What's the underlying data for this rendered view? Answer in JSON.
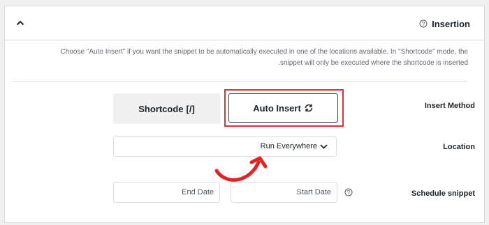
{
  "header": {
    "title": "Insertion"
  },
  "description": {
    "line1": "Choose \"Auto Insert\" if you want the snippet to be automatically executed in one of the locations available. In \"Shortcode\" mode, the",
    "line2": ".snippet will only be executed where the shortcode is inserted"
  },
  "insert_method": {
    "label": "Insert Method",
    "shortcode_label": "Shortcode",
    "shortcode_glyph": "[/]",
    "auto_insert_label": "Auto Insert",
    "selected": "Auto Insert"
  },
  "location": {
    "label": "Location",
    "value": "Run Everywhere"
  },
  "schedule": {
    "label": "Schedule snippet",
    "start_placeholder": "Start Date",
    "end_placeholder": "End Date"
  },
  "colors": {
    "highlight": "#d63638",
    "selected_border": "#2c3e73",
    "annotation_arrow": "#e02424"
  },
  "icons": [
    "chevron-up-icon",
    "help-icon",
    "refresh-icon",
    "chevron-down-icon",
    "curved-arrow-annotation"
  ]
}
